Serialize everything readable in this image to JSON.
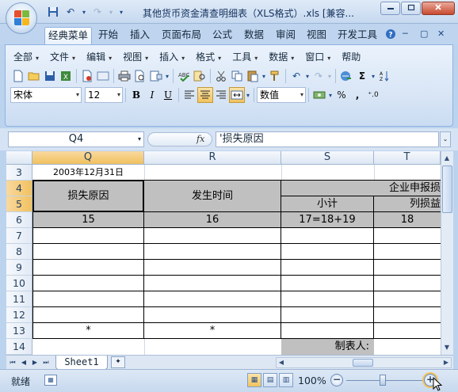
{
  "window": {
    "title": "其他货币资金清查明细表（XLS格式）.xls [兼容...",
    "controls": {
      "minimize": "▭",
      "maximize": "▢",
      "close": "✕"
    }
  },
  "ribbon_tabs": [
    "经典菜单",
    "开始",
    "插入",
    "页面布局",
    "公式",
    "数据",
    "审阅",
    "视图",
    "开发工具"
  ],
  "classic_menu": [
    "全部",
    "文件",
    "编辑",
    "视图",
    "插入",
    "格式",
    "工具",
    "数据",
    "窗口",
    "帮助"
  ],
  "format": {
    "font_name": "宋体",
    "font_size": "12",
    "number_format": "数值",
    "bold": "B",
    "italic": "I",
    "underline": "U"
  },
  "formula_bar": {
    "cell_ref": "Q4",
    "fx": "fx",
    "content": "'损失原因"
  },
  "sheet": {
    "columns": [
      "Q",
      "R",
      "S",
      "T"
    ],
    "selected_column": "Q",
    "rows": [
      "3",
      "4",
      "5",
      "6",
      "7",
      "8",
      "9",
      "10",
      "11",
      "12",
      "13",
      "14"
    ],
    "selected_rows": [
      "4",
      "5"
    ],
    "cells": {
      "q3": "2003年12月31日",
      "q4": "损失原因",
      "r4": "发生时间",
      "st4": "企业申报损",
      "s5": "小计",
      "t5": "列损益",
      "q6": "15",
      "r6": "16",
      "s6": "17=18+19",
      "t6": "18",
      "q13": "*",
      "r13": "*",
      "s14": "制表人:"
    }
  },
  "sheet_tabs": [
    "Sheet1"
  ],
  "status": {
    "mode": "就绪",
    "zoom": "100%",
    "zoom_level": 1.0
  },
  "colors": {
    "header_gray": "#c0c0c0",
    "selection_orange": "#f1c15f",
    "ribbon_blue": "#bfd4ee"
  }
}
